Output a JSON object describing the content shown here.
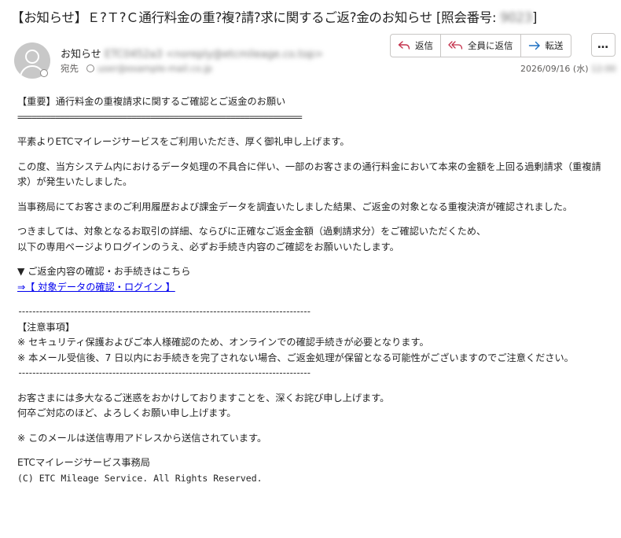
{
  "subject": {
    "prefix": "【お知らせ】Ｅ?Ｔ?Ｃ通行料金の重?複?請?求に関するご返?金のお知らせ [照会番号: ",
    "number_redacted": "9023",
    "suffix": "]"
  },
  "header": {
    "from_label": "お知らせ",
    "from_redacted": "ETC0452a3 <noreply@etcmileage.co.top>",
    "to_label": "宛先",
    "to_redacted": "user@example-mail.co.jp",
    "date": "2026/09/16 (水)",
    "time_redacted": "12:00"
  },
  "actions": {
    "reply": "返信",
    "reply_all": "全員に返信",
    "forward": "転送",
    "more": "…"
  },
  "body": {
    "title": "【重要】通行料金の重複請求に関するご確認とご返金のお願い",
    "rule_eq": "============================================================",
    "p1": "平素よりETCマイレージサービスをご利用いただき、厚く御礼申し上げます。",
    "p2": "この度、当方システム内におけるデータ処理の不具合に伴い、一部のお客さまの通行料金において本来の金額を上回る過剰請求（重複請求）が発生いたしました。",
    "p3": "当事務局にてお客さまのご利用履歴および課金データを調査いたしました結果、ご返金の対象となる重複決済が確認されました。",
    "p4_line1": "つきましては、対象となるお取引の詳細、ならびに正確なご返金金額（過剰請求分）をご確認いただくため、",
    "p4_line2": "以下の専用ページよりログインのうえ、必ずお手続き内容のご確認をお願いいたします。",
    "section_label": "▼ ご返金内容の確認・お手続きはこちら",
    "link": "⇒【 対象データの確認・ログイン 】",
    "rule_dash": "------------------------------------------------------------------------------------",
    "notice_title": "【注意事項】",
    "notice1": "※ セキュリティ保護およびご本人様確認のため、オンラインでの確認手続きが必要となります。",
    "notice2": "※ 本メール受信後、7 日以内にお手続きを完了されない場合、ご返金処理が保留となる可能性がございますのでご注意ください。",
    "closing1": "お客さまには多大なるご迷惑をおかけしておりますことを、深くお詫び申し上げます。",
    "closing2": "何卒ご対応のほど、よろしくお願い申し上げます。",
    "sendonly": "※ このメールは送信専用アドレスから送信されています。",
    "signature": "ETCマイレージサービス事務局",
    "copyright": "(C) ETC Mileage Service. All Rights Reserved."
  },
  "icons": {
    "reply": "reply-icon",
    "reply_all": "reply-all-icon",
    "forward": "forward-icon",
    "more": "more-icon",
    "avatar": "person-icon"
  },
  "colors": {
    "accent": "#c4314b",
    "link": "#0000ee"
  }
}
